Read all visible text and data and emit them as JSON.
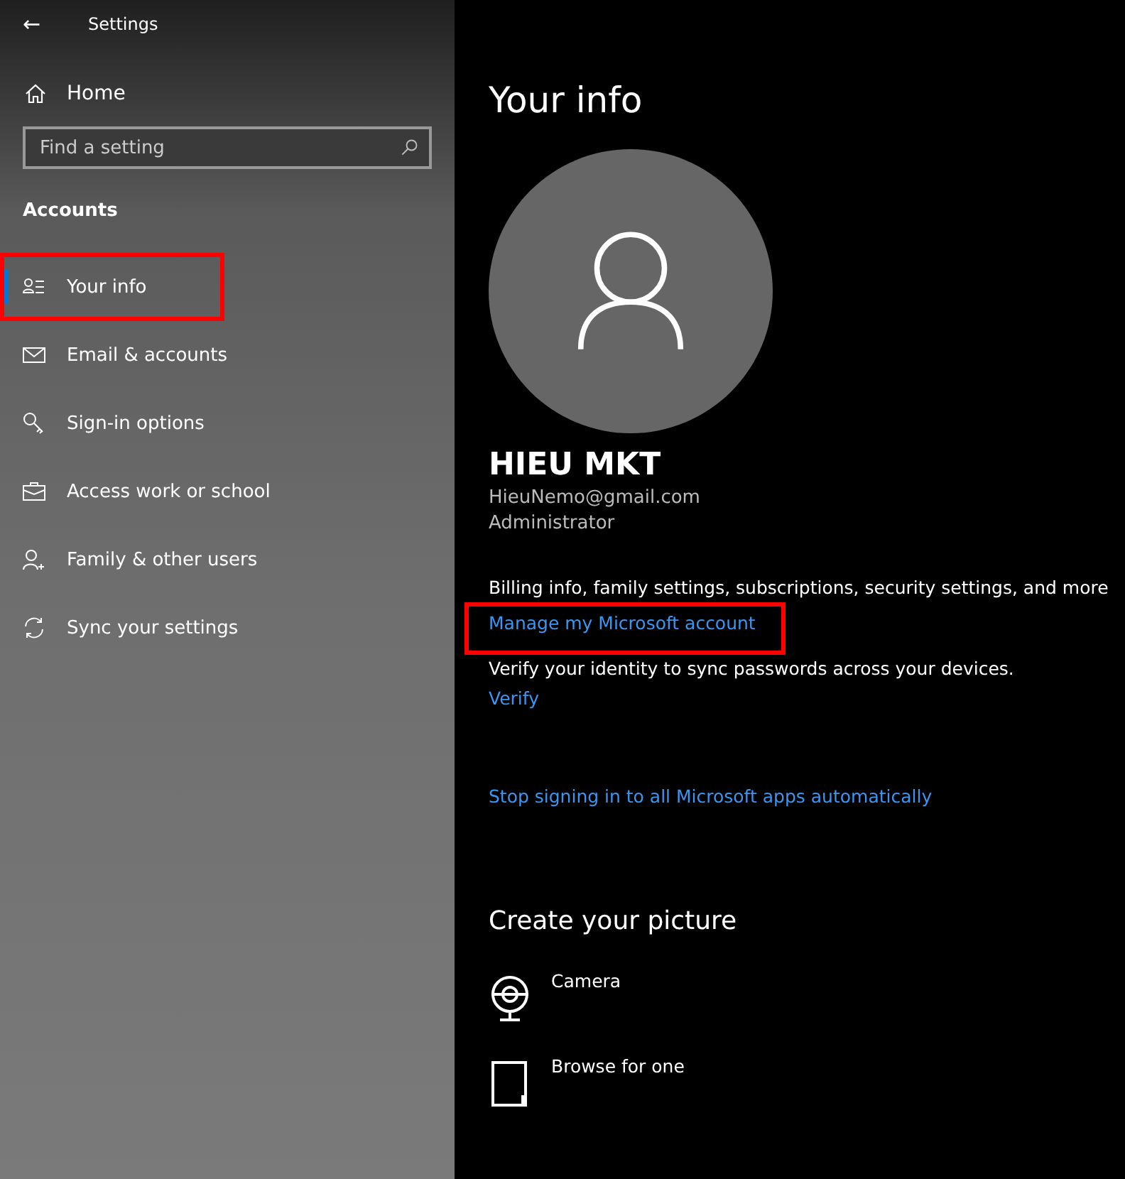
{
  "window": {
    "title": "Settings",
    "back": "←"
  },
  "sidebar": {
    "home": "Home",
    "search": {
      "placeholder": "Find a setting"
    },
    "section": "Accounts",
    "items": [
      {
        "label": "Your info",
        "kind": "person-list",
        "selected": true,
        "highlighted": true
      },
      {
        "label": "Email & accounts",
        "kind": "mail",
        "selected": false,
        "highlighted": false
      },
      {
        "label": "Sign-in options",
        "kind": "key",
        "selected": false,
        "highlighted": false
      },
      {
        "label": "Access work or school",
        "kind": "briefcase",
        "selected": false,
        "highlighted": false
      },
      {
        "label": "Family & other users",
        "kind": "person-add",
        "selected": false,
        "highlighted": false
      },
      {
        "label": "Sync your settings",
        "kind": "sync",
        "selected": false,
        "highlighted": false
      }
    ]
  },
  "main": {
    "title": "Your info",
    "name": "HIEU MKT",
    "email": "HieuNemo@gmail.com",
    "role": "Administrator",
    "blocks": [
      {
        "text": "Billing info, family settings, subscriptions, security settings, and more",
        "link": "Manage my Microsoft account",
        "highlighted": true
      },
      {
        "text": "Verify your identity to sync passwords across your devices.",
        "link": "Verify",
        "highlighted": false
      },
      {
        "link": "Stop signing in to all Microsoft apps automatically",
        "highlighted": false
      }
    ],
    "picture_heading": "Create your picture",
    "picture_options": [
      {
        "label": "Camera",
        "kind": "camera"
      },
      {
        "label": "Browse for one",
        "kind": "file"
      }
    ]
  }
}
